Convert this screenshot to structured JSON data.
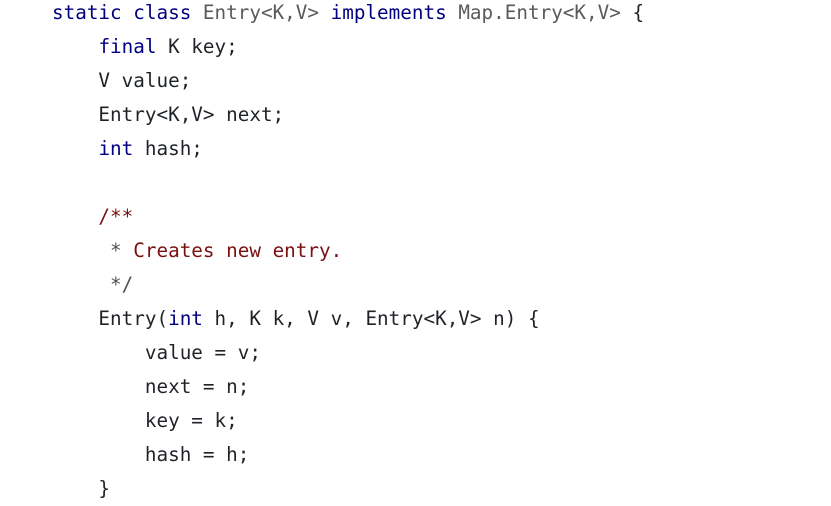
{
  "code": {
    "language": "java",
    "colors": {
      "keyword": "#000080",
      "type": "#5a5a5a",
      "plain": "#1f2328",
      "comment": "#7a0f0f",
      "comment_muted": "#505050",
      "background": "#ffffff"
    },
    "lines": [
      [
        {
          "t": "static",
          "k": "keyword"
        },
        {
          "t": " ",
          "k": "plain"
        },
        {
          "t": "class",
          "k": "keyword"
        },
        {
          "t": " ",
          "k": "plain"
        },
        {
          "t": "Entry<K,V>",
          "k": "type"
        },
        {
          "t": " ",
          "k": "plain"
        },
        {
          "t": "implements",
          "k": "keyword"
        },
        {
          "t": " ",
          "k": "plain"
        },
        {
          "t": "Map.Entry<K,V>",
          "k": "type"
        },
        {
          "t": " {",
          "k": "plain"
        }
      ],
      [
        {
          "t": "    ",
          "k": "plain"
        },
        {
          "t": "final",
          "k": "keyword"
        },
        {
          "t": " K key;",
          "k": "plain"
        }
      ],
      [
        {
          "t": "    V value;",
          "k": "plain"
        }
      ],
      [
        {
          "t": "    Entry<K,V> next;",
          "k": "plain"
        }
      ],
      [
        {
          "t": "    ",
          "k": "plain"
        },
        {
          "t": "int",
          "k": "keyword"
        },
        {
          "t": " hash;",
          "k": "plain"
        }
      ],
      [],
      [
        {
          "t": "    /**",
          "k": "comment"
        }
      ],
      [
        {
          "t": "     *",
          "k": "comment-muted"
        },
        {
          "t": " Creates new entry.",
          "k": "comment"
        }
      ],
      [
        {
          "t": "     */",
          "k": "comment-muted"
        }
      ],
      [
        {
          "t": "    Entry(",
          "k": "plain"
        },
        {
          "t": "int",
          "k": "keyword"
        },
        {
          "t": " h, K k, V v, Entry<K,V> n) {",
          "k": "plain"
        }
      ],
      [
        {
          "t": "        value = v;",
          "k": "plain"
        }
      ],
      [
        {
          "t": "        next = n;",
          "k": "plain"
        }
      ],
      [
        {
          "t": "        key = k;",
          "k": "plain"
        }
      ],
      [
        {
          "t": "        hash = h;",
          "k": "plain"
        }
      ],
      [
        {
          "t": "    }",
          "k": "plain"
        }
      ]
    ]
  }
}
